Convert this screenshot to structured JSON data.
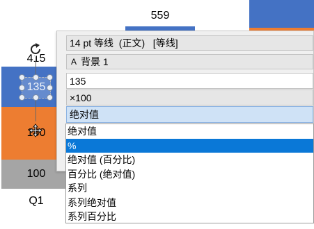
{
  "colors": {
    "series_blue": "#4472c4",
    "series_orange": "#ed7d31",
    "series_gray": "#a5a5a5",
    "selection": "#0a78d7"
  },
  "chart": {
    "value_top": "559",
    "label_blue": "415",
    "label_blue_selected": "135",
    "label_orange": "180",
    "label_gray": "100",
    "category": "Q1"
  },
  "popup": {
    "font_setting": "14 pt 等线  (正文)   [等线]",
    "background_icon": "A",
    "background_label": "背景 1",
    "value_input": "135",
    "multiplier": "×100",
    "mode_selected": "绝对值"
  },
  "dropdown": {
    "options": [
      "绝对值",
      "%",
      "绝对值 (百分比)",
      "百分比 (绝对值)",
      "系列",
      "系列绝对值",
      "系列百分比"
    ],
    "selected_index": 1
  }
}
